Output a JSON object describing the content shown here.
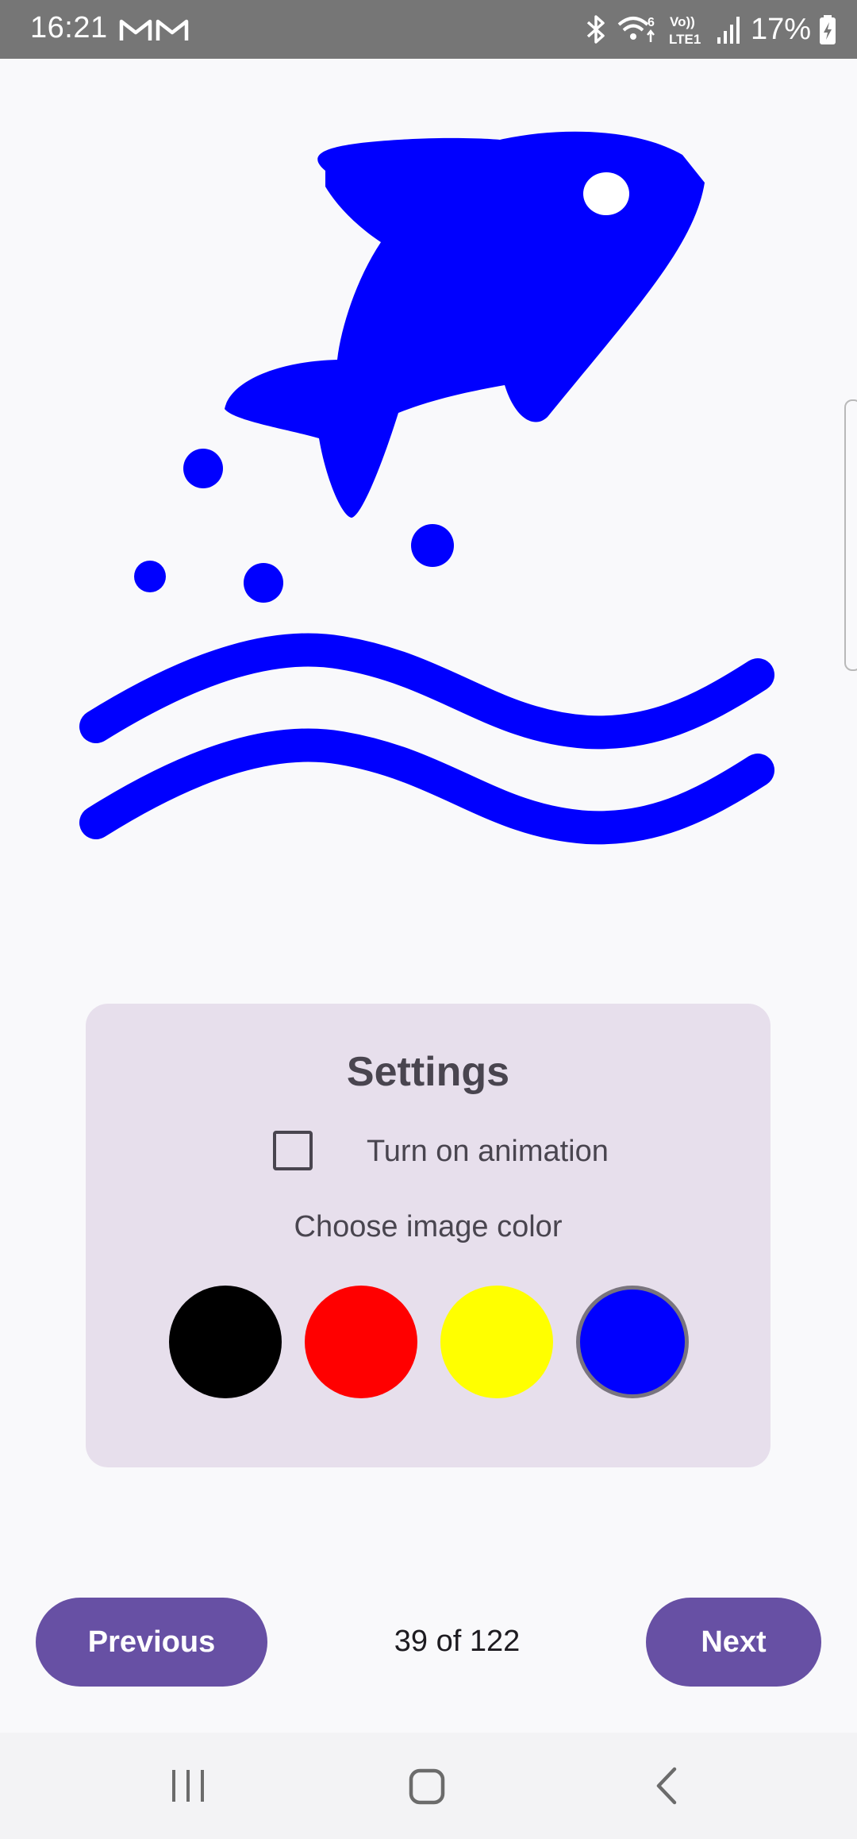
{
  "status_bar": {
    "time": "16:21",
    "battery": "17%",
    "icons": [
      "gmail-icon",
      "gmail-icon",
      "bluetooth-icon",
      "wifi-icon",
      "volte-icon",
      "signal-icon",
      "battery-charging-icon"
    ],
    "volte_label": "Vo))",
    "lte_label": "LTE1"
  },
  "illustration": {
    "icon": "fish-jumping-waves-icon",
    "color": "#0000ff"
  },
  "settings": {
    "title": "Settings",
    "animation_label": "Turn on animation",
    "animation_checked": false,
    "color_label": "Choose image color",
    "colors": [
      {
        "name": "black",
        "hex": "#000000",
        "selected": false
      },
      {
        "name": "red",
        "hex": "#ff0000",
        "selected": false
      },
      {
        "name": "yellow",
        "hex": "#ffff00",
        "selected": false
      },
      {
        "name": "blue",
        "hex": "#0000ff",
        "selected": true
      }
    ]
  },
  "navigation": {
    "previous_label": "Previous",
    "next_label": "Next",
    "page_counter": "39 of 122"
  },
  "system_nav": {
    "icons": [
      "recent-apps-icon",
      "home-icon",
      "back-icon"
    ]
  },
  "theme": {
    "accent": "#6750a4",
    "card_background": "#e7dfec",
    "page_background": "#f9f9fb"
  }
}
